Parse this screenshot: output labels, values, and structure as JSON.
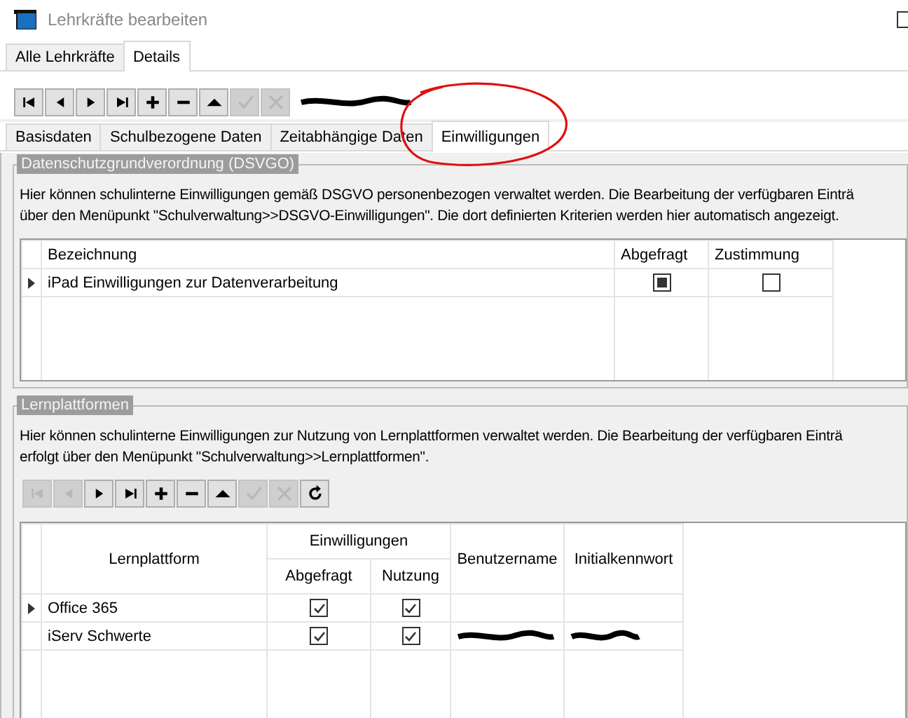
{
  "window": {
    "title": "Lehrkräfte bearbeiten"
  },
  "outer_tabs": [
    {
      "label": "Alle Lehrkräfte",
      "selected": false
    },
    {
      "label": "Details",
      "selected": true
    }
  ],
  "toolbar": [
    {
      "kind": "first",
      "disabled": false
    },
    {
      "kind": "prev",
      "disabled": false
    },
    {
      "kind": "next",
      "disabled": false
    },
    {
      "kind": "last",
      "disabled": false
    },
    {
      "kind": "add",
      "disabled": false
    },
    {
      "kind": "remove",
      "disabled": false
    },
    {
      "kind": "up",
      "disabled": false
    },
    {
      "kind": "confirm",
      "disabled": true
    },
    {
      "kind": "cancel",
      "disabled": true
    }
  ],
  "inner_tabs": [
    {
      "label": "Basisdaten",
      "selected": false
    },
    {
      "label": "Schulbezogene Daten",
      "selected": false
    },
    {
      "label": "Zeitabhängige Daten",
      "selected": false
    },
    {
      "label": "Einwilligungen",
      "selected": true
    }
  ],
  "dsgvo": {
    "title": "Datenschutzgrundverordnung (DSVGO)",
    "description": "Hier können schulinterne Einwilligungen gemäß DSGVO personenbezogen verwaltet werden. Die Bearbeitung der verfügbaren Einträ",
    "description_line2": "über den Menüpunkt \"Schulverwaltung>>DSGVO-Einwilligungen\". Die dort definierten Kriterien werden hier automatisch angezeigt.",
    "columns": [
      "Bezeichnung",
      "Abgefragt",
      "Zustimmung"
    ],
    "rows": [
      {
        "name": "iPad Einwilligungen zur Datenverarbeitung",
        "current": true,
        "abgefragt": true,
        "zustimmung": false
      }
    ]
  },
  "lernplattformen": {
    "title": "Lernplattformen",
    "description": "Hier können schulinterne Einwilligungen zur Nutzung von Lernplattformen verwaltet werden. Die Bearbeitung der verfügbaren Einträ",
    "description_line2": "erfolgt über den Menüpunkt \"Schulverwaltung>>Lernplattformen\".",
    "toolbar": [
      {
        "kind": "first",
        "disabled": true
      },
      {
        "kind": "prev",
        "disabled": true
      },
      {
        "kind": "next",
        "disabled": false
      },
      {
        "kind": "last",
        "disabled": false
      },
      {
        "kind": "add",
        "disabled": false
      },
      {
        "kind": "remove",
        "disabled": false
      },
      {
        "kind": "up",
        "disabled": false
      },
      {
        "kind": "confirm",
        "disabled": true
      },
      {
        "kind": "cancel",
        "disabled": true
      },
      {
        "kind": "refresh",
        "disabled": false
      }
    ],
    "columns": {
      "platform": "Lernplattform",
      "group": "Einwilligungen",
      "abgefragt": "Abgefragt",
      "nutzung": "Nutzung",
      "username": "Benutzername",
      "password": "Initialkennwort"
    },
    "rows": [
      {
        "name": "Office 365",
        "current": true,
        "abgefragt": true,
        "nutzung": true,
        "redacted": false
      },
      {
        "name": "iServ Schwerte",
        "current": false,
        "abgefragt": true,
        "nutzung": true,
        "redacted": true
      }
    ]
  }
}
